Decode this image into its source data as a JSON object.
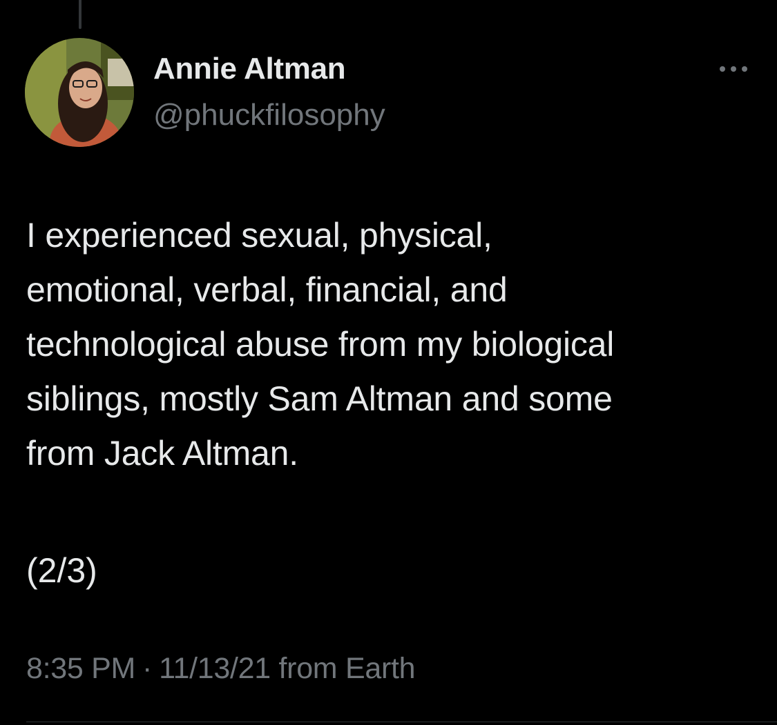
{
  "author": {
    "display_name": "Annie Altman",
    "handle": "@phuckfilosophy",
    "avatar_icon": "profile-photo"
  },
  "tweet": {
    "text": "I experienced sexual, physical,\nemotional, verbal, financial, and\ntechnological abuse from my biological\nsiblings, mostly Sam Altman and some\nfrom Jack Altman.",
    "thread_count": "(2/3)",
    "time": "8:35 PM",
    "separator": "·",
    "date": "11/13/21",
    "source": "from Earth"
  },
  "icons": {
    "more": "more-options-icon"
  },
  "colors": {
    "background": "#000000",
    "primary_text": "#e7e9ea",
    "secondary_text": "#71767b",
    "divider": "#2f3336"
  }
}
